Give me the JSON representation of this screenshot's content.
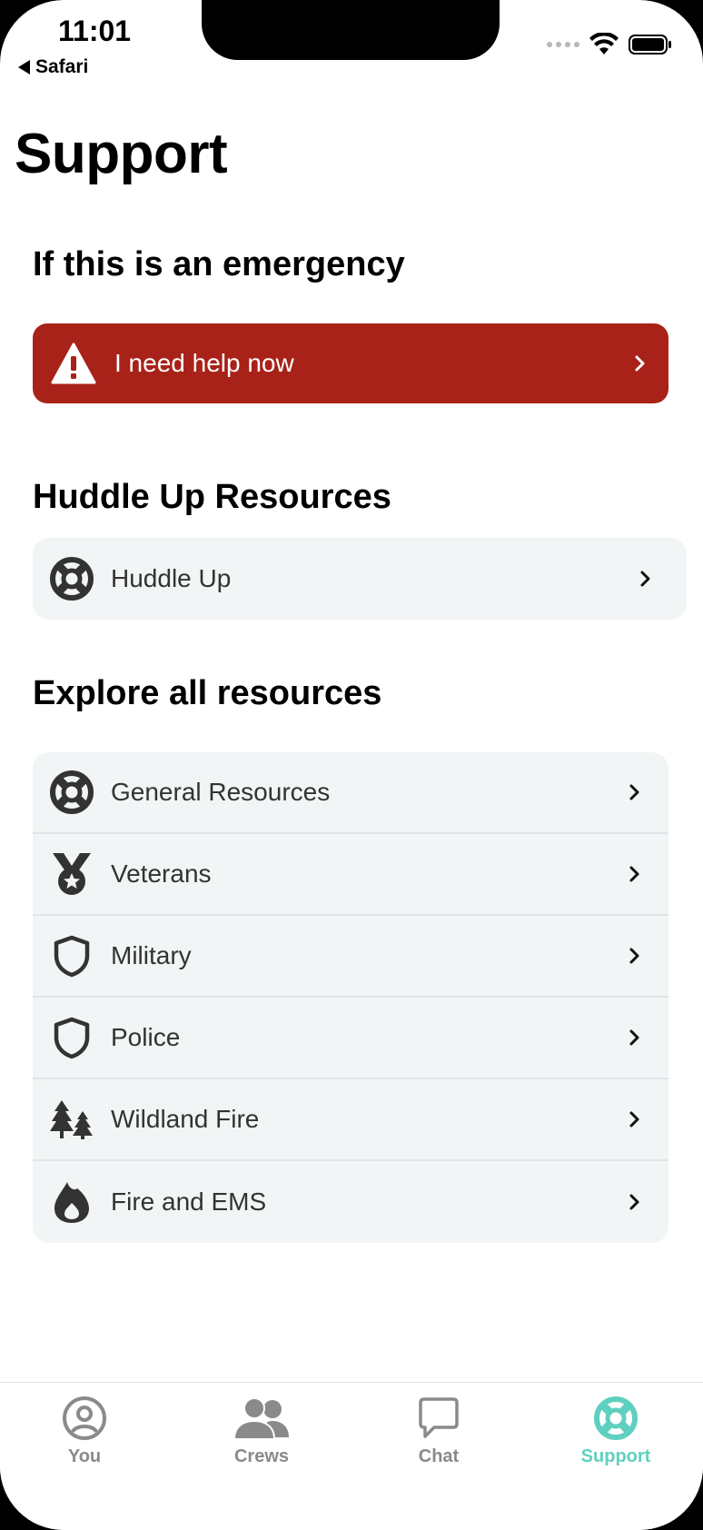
{
  "status_bar": {
    "time": "11:01",
    "back_app": "Safari"
  },
  "page": {
    "title": "Support"
  },
  "emergency_section": {
    "title": "If this is an emergency",
    "button_label": "I need help now",
    "icon": "warning-icon",
    "color": "#a82219"
  },
  "huddle_section": {
    "title": "Huddle Up Resources",
    "items": [
      {
        "label": "Huddle Up",
        "icon": "lifebuoy-icon"
      }
    ]
  },
  "explore_section": {
    "title": "Explore all resources",
    "items": [
      {
        "label": "General Resources",
        "icon": "lifebuoy-icon"
      },
      {
        "label": "Veterans",
        "icon": "medal-icon"
      },
      {
        "label": "Military",
        "icon": "shield-icon"
      },
      {
        "label": "Police",
        "icon": "shield-icon"
      },
      {
        "label": "Wildland Fire",
        "icon": "trees-icon"
      },
      {
        "label": "Fire and EMS",
        "icon": "flame-icon"
      }
    ]
  },
  "tab_bar": {
    "active_color": "#5fd0bf",
    "tabs": [
      {
        "label": "You",
        "icon": "user-circle-icon",
        "active": false
      },
      {
        "label": "Crews",
        "icon": "users-icon",
        "active": false
      },
      {
        "label": "Chat",
        "icon": "chat-bubble-icon",
        "active": false
      },
      {
        "label": "Support",
        "icon": "lifebuoy-icon",
        "active": true
      }
    ]
  }
}
